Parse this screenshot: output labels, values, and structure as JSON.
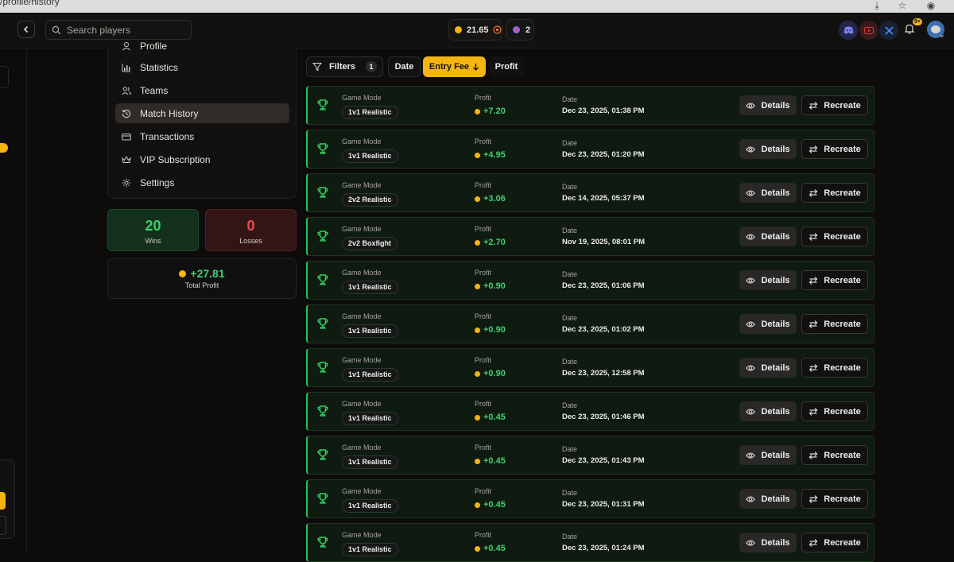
{
  "browser": {
    "url_fragment": "/profile/history"
  },
  "header": {
    "search_placeholder": "Search players",
    "balance": "21.65",
    "tickets": "2",
    "notification_badge": "9+"
  },
  "sidebar": {
    "items": [
      {
        "label": "Profile",
        "icon": "user-icon"
      },
      {
        "label": "Statistics",
        "icon": "bar-chart-icon"
      },
      {
        "label": "Teams",
        "icon": "users-icon"
      },
      {
        "label": "Match History",
        "icon": "history-icon",
        "active": true
      },
      {
        "label": "Transactions",
        "icon": "card-icon"
      },
      {
        "label": "VIP Subscription",
        "icon": "crown-icon"
      },
      {
        "label": "Settings",
        "icon": "gear-icon"
      }
    ]
  },
  "stats": {
    "wins": "20",
    "wins_label": "Wins",
    "losses": "0",
    "losses_label": "Losses",
    "total_profit": "+27.81",
    "total_profit_label": "Total Profit"
  },
  "filters": {
    "filters_label": "Filters",
    "filters_count": "1",
    "date_label": "Date",
    "entry_fee_label": "Entry Fee",
    "profit_label": "Profit"
  },
  "labels": {
    "game_mode": "Game Mode",
    "profit": "Profit",
    "date": "Date",
    "details": "Details",
    "recreate": "Recreate"
  },
  "colors": {
    "accent": "#f5b511",
    "win": "#22c55e",
    "loss": "#ef4444"
  },
  "matches": [
    {
      "mode": "1v1 Realistic",
      "profit": "+7.20",
      "date": "Dec 23, 2025, 01:38 PM"
    },
    {
      "mode": "1v1 Realistic",
      "profit": "+4.95",
      "date": "Dec 23, 2025, 01:20 PM"
    },
    {
      "mode": "2v2 Realistic",
      "profit": "+3.06",
      "date": "Dec 14, 2025, 05:37 PM"
    },
    {
      "mode": "2v2 Boxfight",
      "profit": "+2.70",
      "date": "Nov 19, 2025, 08:01 PM"
    },
    {
      "mode": "1v1 Realistic",
      "profit": "+0.90",
      "date": "Dec 23, 2025, 01:06 PM"
    },
    {
      "mode": "1v1 Realistic",
      "profit": "+0.90",
      "date": "Dec 23, 2025, 01:02 PM"
    },
    {
      "mode": "1v1 Realistic",
      "profit": "+0.90",
      "date": "Dec 23, 2025, 12:58 PM"
    },
    {
      "mode": "1v1 Realistic",
      "profit": "+0.45",
      "date": "Dec 23, 2025, 01:46 PM"
    },
    {
      "mode": "1v1 Realistic",
      "profit": "+0.45",
      "date": "Dec 23, 2025, 01:43 PM"
    },
    {
      "mode": "1v1 Realistic",
      "profit": "+0.45",
      "date": "Dec 23, 2025, 01:31 PM"
    },
    {
      "mode": "1v1 Realistic",
      "profit": "+0.45",
      "date": "Dec 23, 2025, 01:24 PM"
    }
  ]
}
